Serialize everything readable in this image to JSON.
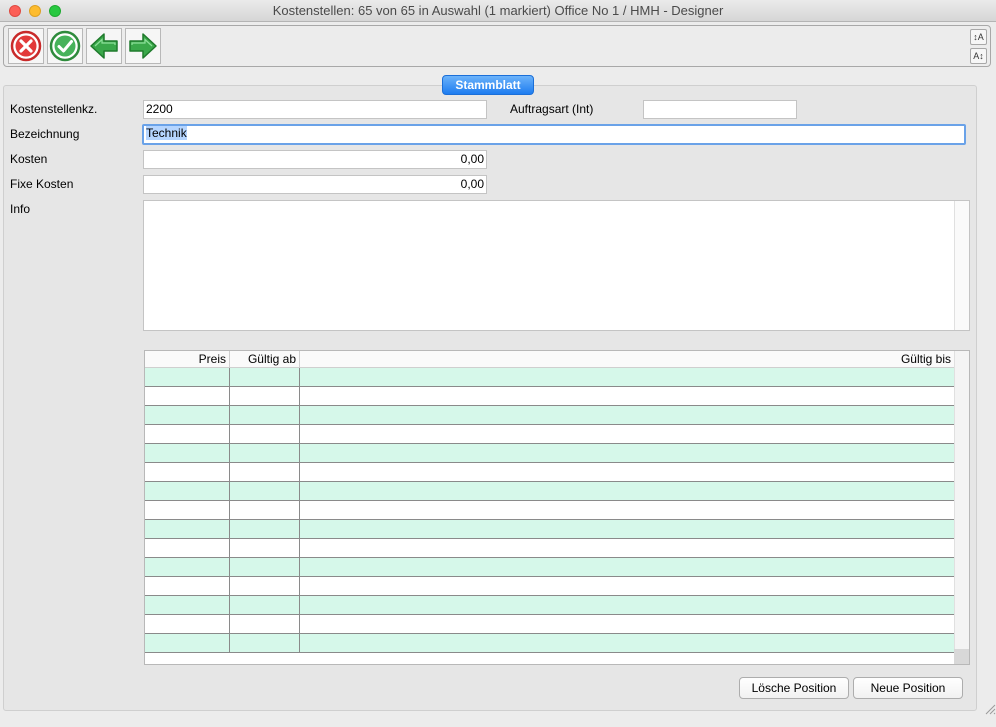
{
  "window": {
    "title": "Kostenstellen: 65 von 65 in Auswahl  (1 markiert) Office No 1 /  HMH - Designer"
  },
  "toolbar": {
    "icons": [
      "cancel-icon",
      "confirm-icon",
      "previous-record-icon",
      "next-record-icon"
    ],
    "font_increase_label": "↕A",
    "font_decrease_label": "A↕"
  },
  "tab": {
    "label": "Stammblatt"
  },
  "form": {
    "kostenstellenkz_label": "Kostenstellenkz.",
    "kostenstellenkz_value": "2200",
    "auftragsart_label": "Auftragsart (Int)",
    "auftragsart_value": "",
    "bezeichnung_label": "Bezeichnung",
    "bezeichnung_value": "Technik",
    "kosten_label": "Kosten",
    "kosten_value": "0,00",
    "fixe_kosten_label": "Fixe Kosten",
    "fixe_kosten_value": "0,00",
    "info_label": "Info",
    "info_value": ""
  },
  "grid": {
    "columns": [
      "Preis",
      "Gültig ab",
      "Gültig bis"
    ],
    "rows": []
  },
  "buttons": {
    "delete_label": "Lösche Position",
    "new_label": "Neue Position"
  },
  "colors": {
    "accent": "#1e7cf0",
    "row_alt": "#d6f8ea",
    "cancel_red": "#e23a3a",
    "confirm_green": "#3aa84a"
  }
}
